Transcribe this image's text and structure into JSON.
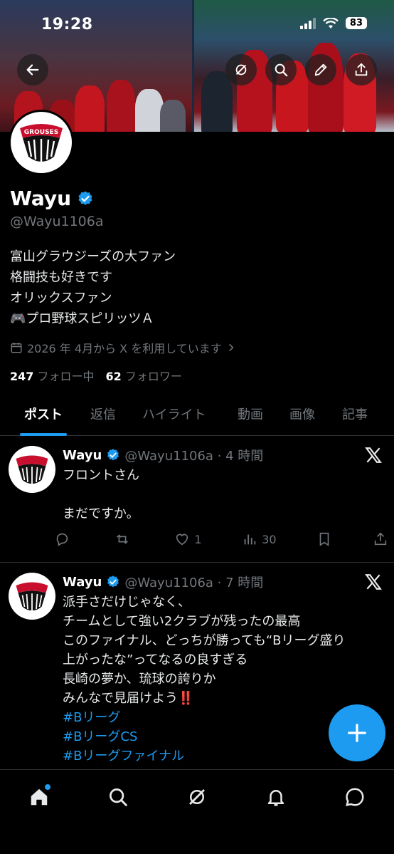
{
  "status": {
    "time": "19:28",
    "battery": "83"
  },
  "profile": {
    "name": "Wayu",
    "handle": "@Wayu1106a",
    "bio": [
      "富山グラウジーズの大ファン",
      "格闘技も好きです",
      "オリックスファン",
      "🎮プロ野球スピリッツＡ"
    ],
    "joined": "2026 年 4月から X を利用しています",
    "following_count": "247",
    "following_label": "フォロー中",
    "followers_count": "62",
    "followers_label": "フォロワー",
    "avatar_icon": "grouses-logo"
  },
  "tabs": [
    {
      "label": "ポスト",
      "active": true
    },
    {
      "label": "返信"
    },
    {
      "label": "ハイライト"
    },
    {
      "label": "動画"
    },
    {
      "label": "画像"
    },
    {
      "label": "記事"
    }
  ],
  "posts": [
    {
      "name": "Wayu",
      "meta": "@Wayu1106a · 4 時間",
      "lines": [
        "フロントさん",
        "",
        "まだですか。"
      ],
      "reply": "",
      "repost": "",
      "likes": "1",
      "views": "30"
    },
    {
      "name": "Wayu",
      "meta": "@Wayu1106a · 7 時間",
      "lines": [
        "派手さだけじゃなく、",
        "チームとして強い2クラブが残ったの最高",
        "このファイナル、どっちが勝っても“Bリーグ盛り",
        "上がったな”ってなるの良すぎる",
        "長崎の夢か、琉球の誇りか",
        "みんなで見届けよう‼️"
      ],
      "tags": [
        "#Bリーグ",
        "#BリーグCS",
        "#Bリーグファイナル"
      ]
    }
  ],
  "colors": {
    "accent": "#1d9bf0",
    "secondary_text": "#71767b",
    "background": "#000000",
    "avatar_red": "#c8102e"
  }
}
